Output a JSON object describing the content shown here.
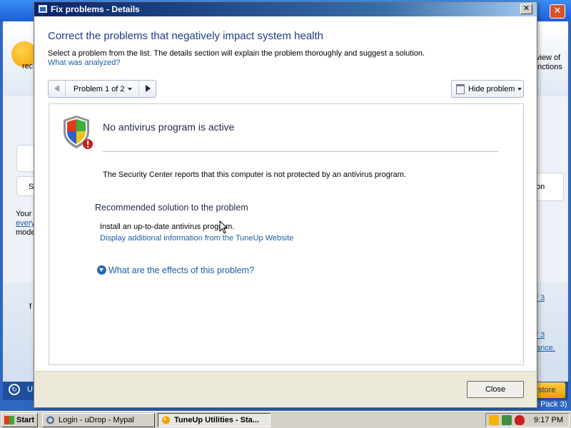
{
  "dialog": {
    "title": "Fix problems - Details",
    "close_glyph": "✕",
    "heading": "Correct the problems that negatively impact system health",
    "instruction": "Select a problem from the list. The details section will explain the problem thoroughly and suggest a solution.",
    "analyzed_link": "What was analyzed?",
    "navigator": {
      "label": "Problem 1 of 2"
    },
    "hide_button": "Hide problem",
    "problem": {
      "title": "No antivirus program is active",
      "description": "The Security Center reports that this computer is not protected by an antivirus program.",
      "solution_heading": "Recommended solution to the problem",
      "solution_text": "Install an up-to-date antivirus program.",
      "solution_link": "Display additional information from the TuneUp Website",
      "effects_link": "What are the effects of this problem?"
    },
    "close_button": "Close"
  },
  "background_app": {
    "close_glyph": "✕",
    "frag_rec": "rec",
    "frag_view_of": "view of",
    "frag_nctions": "nctions",
    "frag_s": "S",
    "frag_on": "on",
    "frag_your": "Your",
    "frag_every": "every",
    "frag_mode": "mode",
    "frag_f": "f",
    "frag_f3a": "f 3",
    "frag_f3b": "f 3",
    "frag_ance": "ance.",
    "frag_pack": "e Pack 3)",
    "frag_u": "U",
    "store_button": "store"
  },
  "taskbar": {
    "start": "Start",
    "tasks": [
      {
        "label": "Login - uDrop - Mypal"
      },
      {
        "label": "TuneUp Utilities - Sta..."
      }
    ],
    "clock": "9:17 PM"
  },
  "colors": {
    "heading": "#1f3c88",
    "link": "#1a5ea8",
    "titlebar_start": "#0a246a",
    "taskbar": "#d4d0c8"
  }
}
